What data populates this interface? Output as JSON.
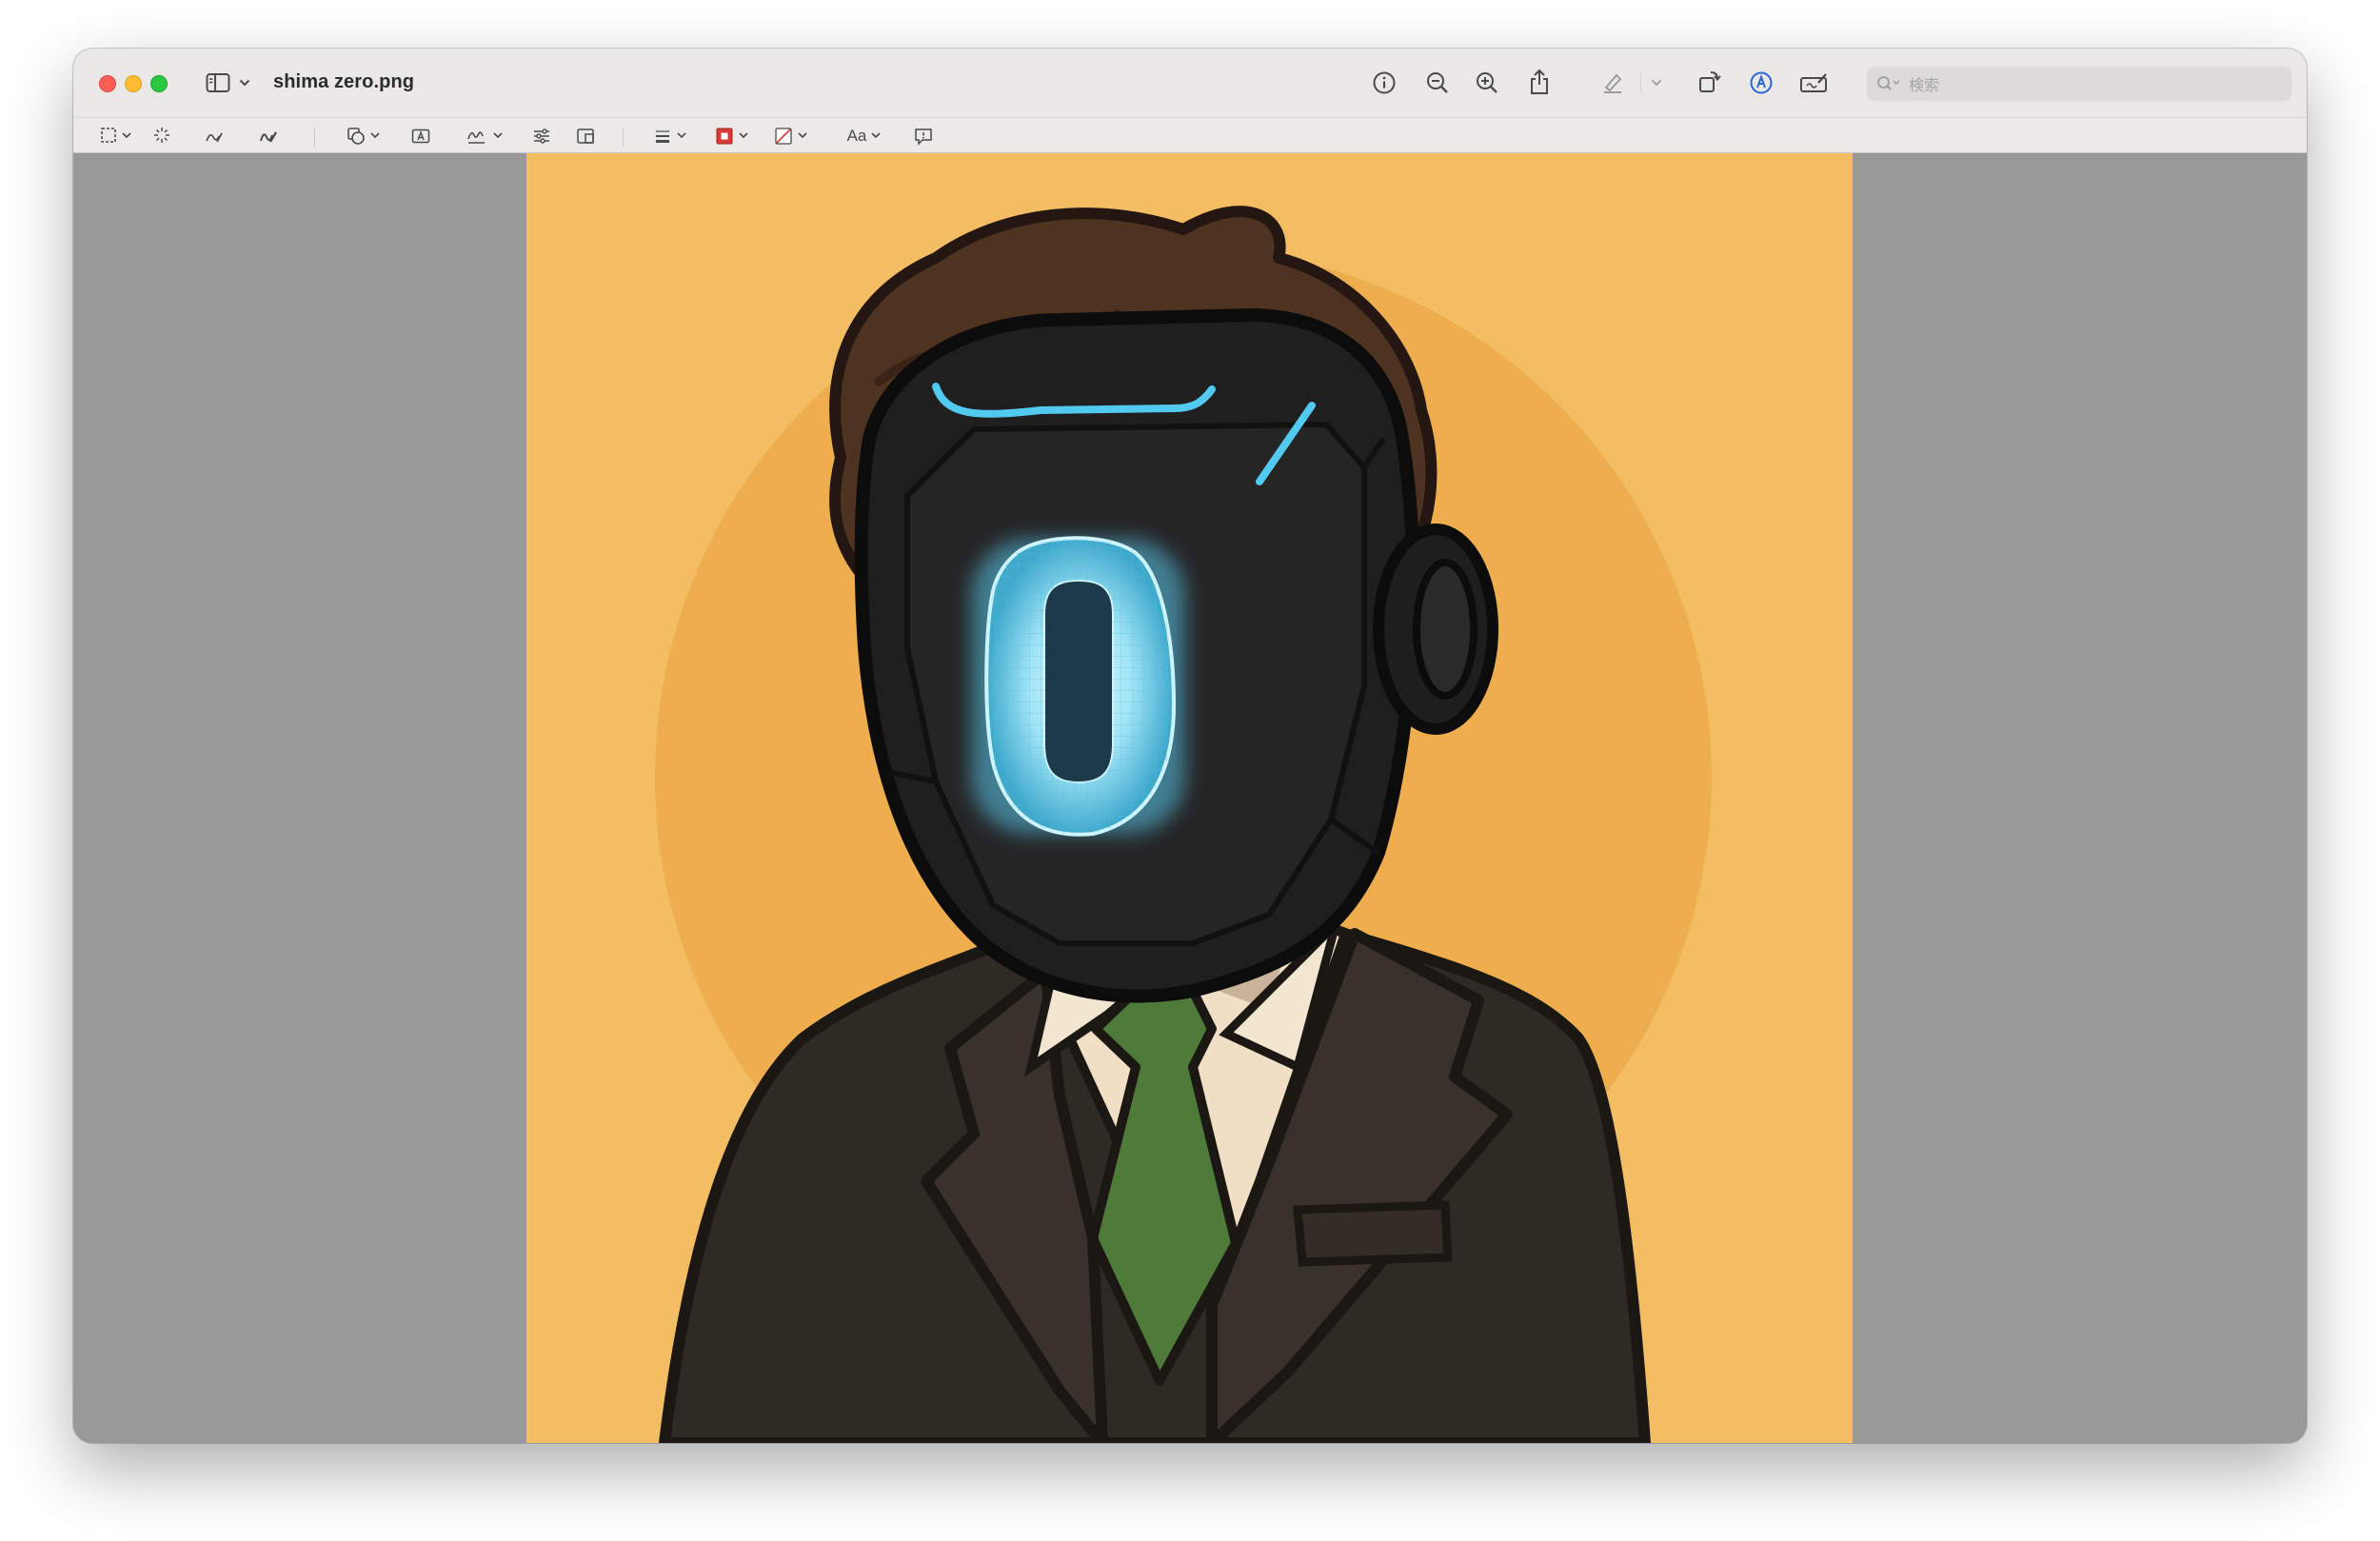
{
  "window": {
    "title": "shima zero.png"
  },
  "search": {
    "placeholder": "検索"
  },
  "markup": {
    "text_style_label": "Aa"
  },
  "image": {
    "visor_character": "0"
  },
  "colors": {
    "background_orange": "#f2bd63",
    "halo_orange": "#eeae4e",
    "suit_dark": "#2f2a23",
    "helmet_black": "#1f1f20",
    "visor_glow": "#9fe4f6",
    "tie_green": "#4e7a3a",
    "hair_brown": "#4f3321",
    "window_gray": "#999999",
    "titlebar": "#e9e8e6"
  }
}
